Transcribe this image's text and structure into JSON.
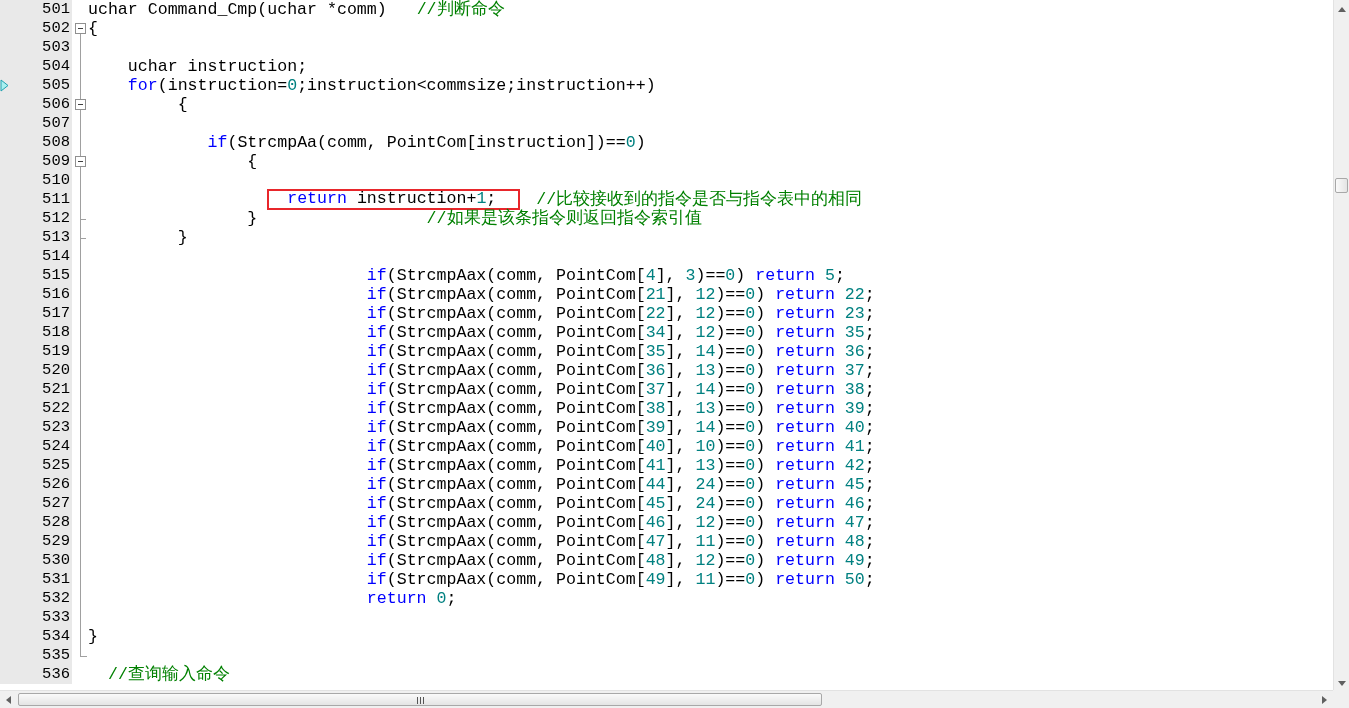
{
  "editor": {
    "lines": [
      {
        "number": "501",
        "kind": "plain",
        "segments": [
          {
            "tokens": [
              {
                "kind": "plain",
                "text": "uchar Command_Cmp(uchar *comm)"
              }
            ]
          },
          {
            "tokens": [
              {
                "kind": "comment",
                "text": "   //判断命令"
              }
            ]
          }
        ]
      },
      {
        "number": "502",
        "kind": "fold_start",
        "expanded": true,
        "segments": [
          {
            "tokens": [
              {
                "kind": "plain",
                "text": "{"
              }
            ]
          }
        ]
      },
      {
        "number": "503",
        "kind": "plain"
      },
      {
        "number": "504",
        "kind": "plain",
        "segments": [
          {
            "tokens": [
              {
                "kind": "plain",
                "text": "    uchar instruction;"
              }
            ]
          }
        ]
      },
      {
        "number": "505",
        "kind": "plain",
        "current": true,
        "segments": [
          {
            "tokens": [
              {
                "kind": "keyword",
                "text": "    for"
              },
              {
                "kind": "plain",
                "text": "(instruction="
              },
              {
                "kind": "number",
                "text": "0"
              },
              {
                "kind": "plain",
                "text": ";instruction<commsize;instruction++)"
              }
            ]
          }
        ]
      },
      {
        "number": "506",
        "kind": "fold_start",
        "expanded": true,
        "segments": [
          {
            "tokens": [
              {
                "kind": "plain",
                "text": "         {"
              }
            ]
          }
        ]
      },
      {
        "number": "507",
        "kind": "plain"
      },
      {
        "number": "508",
        "kind": "plain",
        "segments": [
          {
            "tokens": [
              {
                "kind": "keyword",
                "text": "            if"
              },
              {
                "kind": "plain",
                "text": "(StrcmpAa(comm, PointCom[instruction])=="
              },
              {
                "kind": "number",
                "text": "0"
              },
              {
                "kind": "plain",
                "text": ")"
              }
            ]
          }
        ]
      },
      {
        "number": "509",
        "kind": "fold_start",
        "expanded": true,
        "segments": [
          {
            "tokens": [
              {
                "kind": "plain",
                "text": "                {"
              }
            ]
          }
        ]
      },
      {
        "number": "510",
        "kind": "plain"
      },
      {
        "number": "511",
        "kind": "plain",
        "segments": [
          {
            "boxed": true,
            "tokens": [
              {
                "kind": "keyword",
                "text": "                    return"
              },
              {
                "kind": "plain",
                "text": " instruction+"
              },
              {
                "kind": "number",
                "text": "1"
              },
              {
                "kind": "plain",
                "text": ";"
              }
            ]
          },
          {
            "tokens": [
              {
                "kind": "comment",
                "text": "    //比较接收到的指令是否与指令表中的相同"
              }
            ]
          }
        ]
      },
      {
        "number": "512",
        "kind": "fold_end",
        "segments": [
          {
            "tokens": [
              {
                "kind": "plain",
                "text": "                }"
              }
            ]
          },
          {
            "tokens": [
              {
                "kind": "comment",
                "text": "                 //如果是该条指令则返回指令索引值"
              }
            ]
          }
        ]
      },
      {
        "number": "513",
        "kind": "fold_end",
        "segments": [
          {
            "tokens": [
              {
                "kind": "plain",
                "text": "         }"
              }
            ]
          }
        ]
      },
      {
        "number": "514",
        "kind": "plain"
      },
      {
        "number": "515",
        "kind": "plain",
        "segments": [
          {
            "tokens": [
              {
                "kind": "keyword",
                "text": "                            if"
              },
              {
                "kind": "plain",
                "text": "(StrcmpAax(comm, PointCom["
              },
              {
                "kind": "number",
                "text": "4"
              },
              {
                "kind": "plain",
                "text": "], "
              },
              {
                "kind": "number",
                "text": "3"
              },
              {
                "kind": "plain",
                "text": ")=="
              },
              {
                "kind": "number",
                "text": "0"
              },
              {
                "kind": "plain",
                "text": ") "
              },
              {
                "kind": "keyword",
                "text": "return"
              },
              {
                "kind": "number",
                "text": " 5"
              },
              {
                "kind": "plain",
                "text": ";"
              }
            ]
          }
        ]
      },
      {
        "number": "516",
        "kind": "plain",
        "segments": [
          {
            "tokens": [
              {
                "kind": "keyword",
                "text": "                            if"
              },
              {
                "kind": "plain",
                "text": "(StrcmpAax(comm, PointCom["
              },
              {
                "kind": "number",
                "text": "21"
              },
              {
                "kind": "plain",
                "text": "], "
              },
              {
                "kind": "number",
                "text": "12"
              },
              {
                "kind": "plain",
                "text": ")=="
              },
              {
                "kind": "number",
                "text": "0"
              },
              {
                "kind": "plain",
                "text": ") "
              },
              {
                "kind": "keyword",
                "text": "return"
              },
              {
                "kind": "number",
                "text": " 22"
              },
              {
                "kind": "plain",
                "text": ";"
              }
            ]
          }
        ]
      },
      {
        "number": "517",
        "kind": "plain",
        "segments": [
          {
            "tokens": [
              {
                "kind": "keyword",
                "text": "                            if"
              },
              {
                "kind": "plain",
                "text": "(StrcmpAax(comm, PointCom["
              },
              {
                "kind": "number",
                "text": "22"
              },
              {
                "kind": "plain",
                "text": "], "
              },
              {
                "kind": "number",
                "text": "12"
              },
              {
                "kind": "plain",
                "text": ")=="
              },
              {
                "kind": "number",
                "text": "0"
              },
              {
                "kind": "plain",
                "text": ") "
              },
              {
                "kind": "keyword",
                "text": "return"
              },
              {
                "kind": "number",
                "text": " 23"
              },
              {
                "kind": "plain",
                "text": ";"
              }
            ]
          }
        ]
      },
      {
        "number": "518",
        "kind": "plain",
        "segments": [
          {
            "tokens": [
              {
                "kind": "keyword",
                "text": "                            if"
              },
              {
                "kind": "plain",
                "text": "(StrcmpAax(comm, PointCom["
              },
              {
                "kind": "number",
                "text": "34"
              },
              {
                "kind": "plain",
                "text": "], "
              },
              {
                "kind": "number",
                "text": "12"
              },
              {
                "kind": "plain",
                "text": ")=="
              },
              {
                "kind": "number",
                "text": "0"
              },
              {
                "kind": "plain",
                "text": ") "
              },
              {
                "kind": "keyword",
                "text": "return"
              },
              {
                "kind": "number",
                "text": " 35"
              },
              {
                "kind": "plain",
                "text": ";"
              }
            ]
          }
        ]
      },
      {
        "number": "519",
        "kind": "plain",
        "segments": [
          {
            "tokens": [
              {
                "kind": "keyword",
                "text": "                            if"
              },
              {
                "kind": "plain",
                "text": "(StrcmpAax(comm, PointCom["
              },
              {
                "kind": "number",
                "text": "35"
              },
              {
                "kind": "plain",
                "text": "], "
              },
              {
                "kind": "number",
                "text": "14"
              },
              {
                "kind": "plain",
                "text": ")=="
              },
              {
                "kind": "number",
                "text": "0"
              },
              {
                "kind": "plain",
                "text": ") "
              },
              {
                "kind": "keyword",
                "text": "return"
              },
              {
                "kind": "number",
                "text": " 36"
              },
              {
                "kind": "plain",
                "text": ";"
              }
            ]
          }
        ]
      },
      {
        "number": "520",
        "kind": "plain",
        "segments": [
          {
            "tokens": [
              {
                "kind": "keyword",
                "text": "                            if"
              },
              {
                "kind": "plain",
                "text": "(StrcmpAax(comm, PointCom["
              },
              {
                "kind": "number",
                "text": "36"
              },
              {
                "kind": "plain",
                "text": "], "
              },
              {
                "kind": "number",
                "text": "13"
              },
              {
                "kind": "plain",
                "text": ")=="
              },
              {
                "kind": "number",
                "text": "0"
              },
              {
                "kind": "plain",
                "text": ") "
              },
              {
                "kind": "keyword",
                "text": "return"
              },
              {
                "kind": "number",
                "text": " 37"
              },
              {
                "kind": "plain",
                "text": ";"
              }
            ]
          }
        ]
      },
      {
        "number": "521",
        "kind": "plain",
        "segments": [
          {
            "tokens": [
              {
                "kind": "keyword",
                "text": "                            if"
              },
              {
                "kind": "plain",
                "text": "(StrcmpAax(comm, PointCom["
              },
              {
                "kind": "number",
                "text": "37"
              },
              {
                "kind": "plain",
                "text": "], "
              },
              {
                "kind": "number",
                "text": "14"
              },
              {
                "kind": "plain",
                "text": ")=="
              },
              {
                "kind": "number",
                "text": "0"
              },
              {
                "kind": "plain",
                "text": ") "
              },
              {
                "kind": "keyword",
                "text": "return"
              },
              {
                "kind": "number",
                "text": " 38"
              },
              {
                "kind": "plain",
                "text": ";"
              }
            ]
          }
        ]
      },
      {
        "number": "522",
        "kind": "plain",
        "segments": [
          {
            "tokens": [
              {
                "kind": "keyword",
                "text": "                            if"
              },
              {
                "kind": "plain",
                "text": "(StrcmpAax(comm, PointCom["
              },
              {
                "kind": "number",
                "text": "38"
              },
              {
                "kind": "plain",
                "text": "], "
              },
              {
                "kind": "number",
                "text": "13"
              },
              {
                "kind": "plain",
                "text": ")=="
              },
              {
                "kind": "number",
                "text": "0"
              },
              {
                "kind": "plain",
                "text": ") "
              },
              {
                "kind": "keyword",
                "text": "return"
              },
              {
                "kind": "number",
                "text": " 39"
              },
              {
                "kind": "plain",
                "text": ";"
              }
            ]
          }
        ]
      },
      {
        "number": "523",
        "kind": "plain",
        "segments": [
          {
            "tokens": [
              {
                "kind": "keyword",
                "text": "                            if"
              },
              {
                "kind": "plain",
                "text": "(StrcmpAax(comm, PointCom["
              },
              {
                "kind": "number",
                "text": "39"
              },
              {
                "kind": "plain",
                "text": "], "
              },
              {
                "kind": "number",
                "text": "14"
              },
              {
                "kind": "plain",
                "text": ")=="
              },
              {
                "kind": "number",
                "text": "0"
              },
              {
                "kind": "plain",
                "text": ") "
              },
              {
                "kind": "keyword",
                "text": "return"
              },
              {
                "kind": "number",
                "text": " 40"
              },
              {
                "kind": "plain",
                "text": ";"
              }
            ]
          }
        ]
      },
      {
        "number": "524",
        "kind": "plain",
        "segments": [
          {
            "tokens": [
              {
                "kind": "keyword",
                "text": "                            if"
              },
              {
                "kind": "plain",
                "text": "(StrcmpAax(comm, PointCom["
              },
              {
                "kind": "number",
                "text": "40"
              },
              {
                "kind": "plain",
                "text": "], "
              },
              {
                "kind": "number",
                "text": "10"
              },
              {
                "kind": "plain",
                "text": ")=="
              },
              {
                "kind": "number",
                "text": "0"
              },
              {
                "kind": "plain",
                "text": ") "
              },
              {
                "kind": "keyword",
                "text": "return"
              },
              {
                "kind": "number",
                "text": " 41"
              },
              {
                "kind": "plain",
                "text": ";"
              }
            ]
          }
        ]
      },
      {
        "number": "525",
        "kind": "plain",
        "segments": [
          {
            "tokens": [
              {
                "kind": "keyword",
                "text": "                            if"
              },
              {
                "kind": "plain",
                "text": "(StrcmpAax(comm, PointCom["
              },
              {
                "kind": "number",
                "text": "41"
              },
              {
                "kind": "plain",
                "text": "], "
              },
              {
                "kind": "number",
                "text": "13"
              },
              {
                "kind": "plain",
                "text": ")=="
              },
              {
                "kind": "number",
                "text": "0"
              },
              {
                "kind": "plain",
                "text": ") "
              },
              {
                "kind": "keyword",
                "text": "return"
              },
              {
                "kind": "number",
                "text": " 42"
              },
              {
                "kind": "plain",
                "text": ";"
              }
            ]
          }
        ]
      },
      {
        "number": "526",
        "kind": "plain",
        "segments": [
          {
            "tokens": [
              {
                "kind": "keyword",
                "text": "                            if"
              },
              {
                "kind": "plain",
                "text": "(StrcmpAax(comm, PointCom["
              },
              {
                "kind": "number",
                "text": "44"
              },
              {
                "kind": "plain",
                "text": "], "
              },
              {
                "kind": "number",
                "text": "24"
              },
              {
                "kind": "plain",
                "text": ")=="
              },
              {
                "kind": "number",
                "text": "0"
              },
              {
                "kind": "plain",
                "text": ") "
              },
              {
                "kind": "keyword",
                "text": "return"
              },
              {
                "kind": "number",
                "text": " 45"
              },
              {
                "kind": "plain",
                "text": ";"
              }
            ]
          }
        ]
      },
      {
        "number": "527",
        "kind": "plain",
        "segments": [
          {
            "tokens": [
              {
                "kind": "keyword",
                "text": "                            if"
              },
              {
                "kind": "plain",
                "text": "(StrcmpAax(comm, PointCom["
              },
              {
                "kind": "number",
                "text": "45"
              },
              {
                "kind": "plain",
                "text": "], "
              },
              {
                "kind": "number",
                "text": "24"
              },
              {
                "kind": "plain",
                "text": ")=="
              },
              {
                "kind": "number",
                "text": "0"
              },
              {
                "kind": "plain",
                "text": ") "
              },
              {
                "kind": "keyword",
                "text": "return"
              },
              {
                "kind": "number",
                "text": " 46"
              },
              {
                "kind": "plain",
                "text": ";"
              }
            ]
          }
        ]
      },
      {
        "number": "528",
        "kind": "plain",
        "segments": [
          {
            "tokens": [
              {
                "kind": "keyword",
                "text": "                            if"
              },
              {
                "kind": "plain",
                "text": "(StrcmpAax(comm, PointCom["
              },
              {
                "kind": "number",
                "text": "46"
              },
              {
                "kind": "plain",
                "text": "], "
              },
              {
                "kind": "number",
                "text": "12"
              },
              {
                "kind": "plain",
                "text": ")=="
              },
              {
                "kind": "number",
                "text": "0"
              },
              {
                "kind": "plain",
                "text": ") "
              },
              {
                "kind": "keyword",
                "text": "return"
              },
              {
                "kind": "number",
                "text": " 47"
              },
              {
                "kind": "plain",
                "text": ";"
              }
            ]
          }
        ]
      },
      {
        "number": "529",
        "kind": "plain",
        "segments": [
          {
            "tokens": [
              {
                "kind": "keyword",
                "text": "                            if"
              },
              {
                "kind": "plain",
                "text": "(StrcmpAax(comm, PointCom["
              },
              {
                "kind": "number",
                "text": "47"
              },
              {
                "kind": "plain",
                "text": "], "
              },
              {
                "kind": "number",
                "text": "11"
              },
              {
                "kind": "plain",
                "text": ")=="
              },
              {
                "kind": "number",
                "text": "0"
              },
              {
                "kind": "plain",
                "text": ") "
              },
              {
                "kind": "keyword",
                "text": "return"
              },
              {
                "kind": "number",
                "text": " 48"
              },
              {
                "kind": "plain",
                "text": ";"
              }
            ]
          }
        ]
      },
      {
        "number": "530",
        "kind": "plain",
        "segments": [
          {
            "tokens": [
              {
                "kind": "keyword",
                "text": "                            if"
              },
              {
                "kind": "plain",
                "text": "(StrcmpAax(comm, PointCom["
              },
              {
                "kind": "number",
                "text": "48"
              },
              {
                "kind": "plain",
                "text": "], "
              },
              {
                "kind": "number",
                "text": "12"
              },
              {
                "kind": "plain",
                "text": ")=="
              },
              {
                "kind": "number",
                "text": "0"
              },
              {
                "kind": "plain",
                "text": ") "
              },
              {
                "kind": "keyword",
                "text": "return"
              },
              {
                "kind": "number",
                "text": " 49"
              },
              {
                "kind": "plain",
                "text": ";"
              }
            ]
          }
        ]
      },
      {
        "number": "531",
        "kind": "plain",
        "segments": [
          {
            "tokens": [
              {
                "kind": "keyword",
                "text": "                            if"
              },
              {
                "kind": "plain",
                "text": "(StrcmpAax(comm, PointCom["
              },
              {
                "kind": "number",
                "text": "49"
              },
              {
                "kind": "plain",
                "text": "], "
              },
              {
                "kind": "number",
                "text": "11"
              },
              {
                "kind": "plain",
                "text": ")=="
              },
              {
                "kind": "number",
                "text": "0"
              },
              {
                "kind": "plain",
                "text": ") "
              },
              {
                "kind": "keyword",
                "text": "return"
              },
              {
                "kind": "number",
                "text": " 50"
              },
              {
                "kind": "plain",
                "text": ";"
              }
            ]
          }
        ]
      },
      {
        "number": "532",
        "kind": "plain",
        "segments": [
          {
            "tokens": [
              {
                "kind": "keyword",
                "text": "                            return"
              },
              {
                "kind": "number",
                "text": " 0"
              },
              {
                "kind": "plain",
                "text": ";"
              }
            ]
          }
        ]
      },
      {
        "number": "533",
        "kind": "plain"
      },
      {
        "number": "534",
        "kind": "plain",
        "segments": [
          {
            "tokens": [
              {
                "kind": "plain",
                "text": "}"
              }
            ]
          }
        ]
      },
      {
        "number": "535",
        "kind": "fold_last"
      },
      {
        "number": "536",
        "kind": "plain",
        "segments": [
          {
            "tokens": [
              {
                "kind": "comment",
                "text": "  //查询输入命令"
              }
            ]
          }
        ]
      }
    ]
  }
}
